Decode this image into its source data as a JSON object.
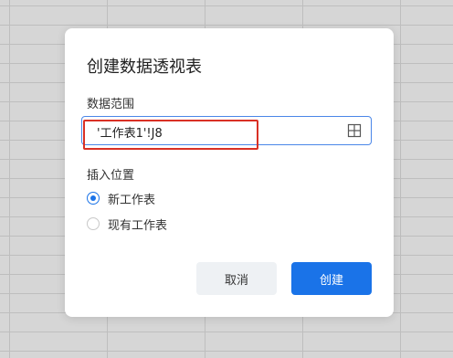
{
  "dialog": {
    "title": "创建数据透视表",
    "data_range": {
      "label": "数据范围",
      "value": "'工作表1'!J8",
      "icon": "grid-select-icon"
    },
    "insert_position": {
      "label": "插入位置",
      "options": [
        {
          "label": "新工作表",
          "selected": true
        },
        {
          "label": "现有工作表",
          "selected": false
        }
      ]
    },
    "buttons": {
      "cancel": "取消",
      "create": "创建"
    }
  },
  "colors": {
    "primary": "#1a73e8",
    "highlight": "#d93025"
  }
}
